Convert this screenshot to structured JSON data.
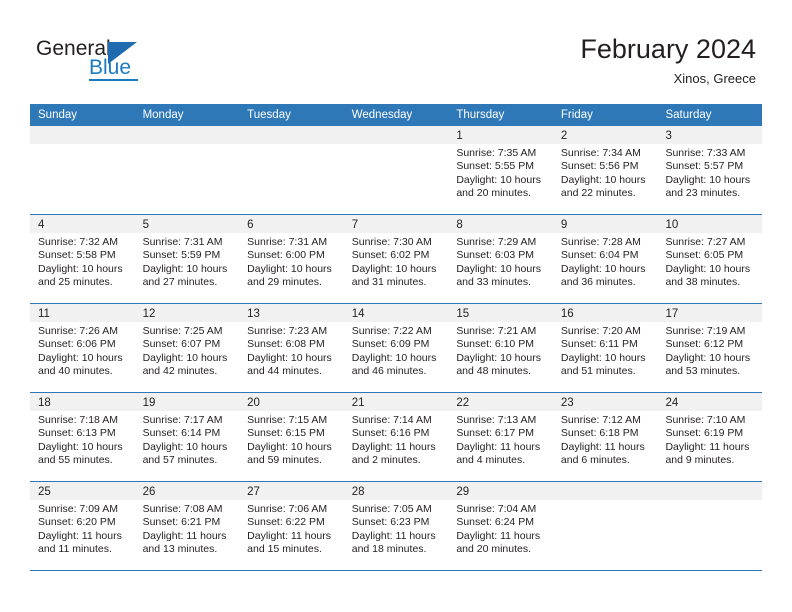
{
  "brand": {
    "name_top": "General",
    "name_bottom": "Blue",
    "accent_color": "#1b7bc1",
    "triangle_color": "#1f6bb0"
  },
  "header": {
    "title": "February 2024",
    "subtitle": "Xinos, Greece"
  },
  "theme": {
    "header_row_bg": "#2e78b8",
    "header_row_text": "#ffffff",
    "day_band_bg": "#f1f1f1",
    "row_rule": "#2e78b8",
    "text": "#231f20"
  },
  "weekdays": [
    "Sunday",
    "Monday",
    "Tuesday",
    "Wednesday",
    "Thursday",
    "Friday",
    "Saturday"
  ],
  "weeks": [
    [
      {
        "day": "",
        "l1": "",
        "l2": "",
        "l3": "",
        "l4": ""
      },
      {
        "day": "",
        "l1": "",
        "l2": "",
        "l3": "",
        "l4": ""
      },
      {
        "day": "",
        "l1": "",
        "l2": "",
        "l3": "",
        "l4": ""
      },
      {
        "day": "",
        "l1": "",
        "l2": "",
        "l3": "",
        "l4": ""
      },
      {
        "day": "1",
        "l1": "Sunrise: 7:35 AM",
        "l2": "Sunset: 5:55 PM",
        "l3": "Daylight: 10 hours",
        "l4": "and 20 minutes."
      },
      {
        "day": "2",
        "l1": "Sunrise: 7:34 AM",
        "l2": "Sunset: 5:56 PM",
        "l3": "Daylight: 10 hours",
        "l4": "and 22 minutes."
      },
      {
        "day": "3",
        "l1": "Sunrise: 7:33 AM",
        "l2": "Sunset: 5:57 PM",
        "l3": "Daylight: 10 hours",
        "l4": "and 23 minutes."
      }
    ],
    [
      {
        "day": "4",
        "l1": "Sunrise: 7:32 AM",
        "l2": "Sunset: 5:58 PM",
        "l3": "Daylight: 10 hours",
        "l4": "and 25 minutes."
      },
      {
        "day": "5",
        "l1": "Sunrise: 7:31 AM",
        "l2": "Sunset: 5:59 PM",
        "l3": "Daylight: 10 hours",
        "l4": "and 27 minutes."
      },
      {
        "day": "6",
        "l1": "Sunrise: 7:31 AM",
        "l2": "Sunset: 6:00 PM",
        "l3": "Daylight: 10 hours",
        "l4": "and 29 minutes."
      },
      {
        "day": "7",
        "l1": "Sunrise: 7:30 AM",
        "l2": "Sunset: 6:02 PM",
        "l3": "Daylight: 10 hours",
        "l4": "and 31 minutes."
      },
      {
        "day": "8",
        "l1": "Sunrise: 7:29 AM",
        "l2": "Sunset: 6:03 PM",
        "l3": "Daylight: 10 hours",
        "l4": "and 33 minutes."
      },
      {
        "day": "9",
        "l1": "Sunrise: 7:28 AM",
        "l2": "Sunset: 6:04 PM",
        "l3": "Daylight: 10 hours",
        "l4": "and 36 minutes."
      },
      {
        "day": "10",
        "l1": "Sunrise: 7:27 AM",
        "l2": "Sunset: 6:05 PM",
        "l3": "Daylight: 10 hours",
        "l4": "and 38 minutes."
      }
    ],
    [
      {
        "day": "11",
        "l1": "Sunrise: 7:26 AM",
        "l2": "Sunset: 6:06 PM",
        "l3": "Daylight: 10 hours",
        "l4": "and 40 minutes."
      },
      {
        "day": "12",
        "l1": "Sunrise: 7:25 AM",
        "l2": "Sunset: 6:07 PM",
        "l3": "Daylight: 10 hours",
        "l4": "and 42 minutes."
      },
      {
        "day": "13",
        "l1": "Sunrise: 7:23 AM",
        "l2": "Sunset: 6:08 PM",
        "l3": "Daylight: 10 hours",
        "l4": "and 44 minutes."
      },
      {
        "day": "14",
        "l1": "Sunrise: 7:22 AM",
        "l2": "Sunset: 6:09 PM",
        "l3": "Daylight: 10 hours",
        "l4": "and 46 minutes."
      },
      {
        "day": "15",
        "l1": "Sunrise: 7:21 AM",
        "l2": "Sunset: 6:10 PM",
        "l3": "Daylight: 10 hours",
        "l4": "and 48 minutes."
      },
      {
        "day": "16",
        "l1": "Sunrise: 7:20 AM",
        "l2": "Sunset: 6:11 PM",
        "l3": "Daylight: 10 hours",
        "l4": "and 51 minutes."
      },
      {
        "day": "17",
        "l1": "Sunrise: 7:19 AM",
        "l2": "Sunset: 6:12 PM",
        "l3": "Daylight: 10 hours",
        "l4": "and 53 minutes."
      }
    ],
    [
      {
        "day": "18",
        "l1": "Sunrise: 7:18 AM",
        "l2": "Sunset: 6:13 PM",
        "l3": "Daylight: 10 hours",
        "l4": "and 55 minutes."
      },
      {
        "day": "19",
        "l1": "Sunrise: 7:17 AM",
        "l2": "Sunset: 6:14 PM",
        "l3": "Daylight: 10 hours",
        "l4": "and 57 minutes."
      },
      {
        "day": "20",
        "l1": "Sunrise: 7:15 AM",
        "l2": "Sunset: 6:15 PM",
        "l3": "Daylight: 10 hours",
        "l4": "and 59 minutes."
      },
      {
        "day": "21",
        "l1": "Sunrise: 7:14 AM",
        "l2": "Sunset: 6:16 PM",
        "l3": "Daylight: 11 hours",
        "l4": "and 2 minutes."
      },
      {
        "day": "22",
        "l1": "Sunrise: 7:13 AM",
        "l2": "Sunset: 6:17 PM",
        "l3": "Daylight: 11 hours",
        "l4": "and 4 minutes."
      },
      {
        "day": "23",
        "l1": "Sunrise: 7:12 AM",
        "l2": "Sunset: 6:18 PM",
        "l3": "Daylight: 11 hours",
        "l4": "and 6 minutes."
      },
      {
        "day": "24",
        "l1": "Sunrise: 7:10 AM",
        "l2": "Sunset: 6:19 PM",
        "l3": "Daylight: 11 hours",
        "l4": "and 9 minutes."
      }
    ],
    [
      {
        "day": "25",
        "l1": "Sunrise: 7:09 AM",
        "l2": "Sunset: 6:20 PM",
        "l3": "Daylight: 11 hours",
        "l4": "and 11 minutes."
      },
      {
        "day": "26",
        "l1": "Sunrise: 7:08 AM",
        "l2": "Sunset: 6:21 PM",
        "l3": "Daylight: 11 hours",
        "l4": "and 13 minutes."
      },
      {
        "day": "27",
        "l1": "Sunrise: 7:06 AM",
        "l2": "Sunset: 6:22 PM",
        "l3": "Daylight: 11 hours",
        "l4": "and 15 minutes."
      },
      {
        "day": "28",
        "l1": "Sunrise: 7:05 AM",
        "l2": "Sunset: 6:23 PM",
        "l3": "Daylight: 11 hours",
        "l4": "and 18 minutes."
      },
      {
        "day": "29",
        "l1": "Sunrise: 7:04 AM",
        "l2": "Sunset: 6:24 PM",
        "l3": "Daylight: 11 hours",
        "l4": "and 20 minutes."
      },
      {
        "day": "",
        "l1": "",
        "l2": "",
        "l3": "",
        "l4": ""
      },
      {
        "day": "",
        "l1": "",
        "l2": "",
        "l3": "",
        "l4": ""
      }
    ]
  ]
}
